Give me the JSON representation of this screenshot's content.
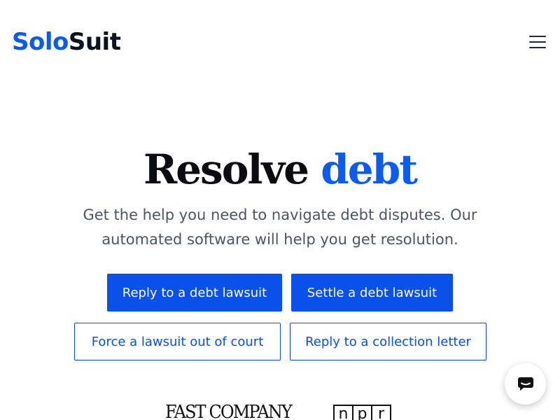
{
  "header": {
    "logo": {
      "part1": "Solo",
      "part2": "Suit"
    },
    "menu_icon": "hamburger-menu-icon"
  },
  "hero": {
    "headline": {
      "main": "Resolve ",
      "accent": "debt"
    },
    "subtext": "Get the help you need to navigate debt disputes. Our automated software will help you get resolution."
  },
  "actions": {
    "reply_lawsuit": "Reply to a debt lawsuit",
    "settle_lawsuit": "Settle a debt lawsuit",
    "force_out_of_court": "Force a lawsuit out of court",
    "reply_collection_letter": "Reply to a collection letter"
  },
  "press": {
    "fast_company": "FAST COMPANY",
    "npr": [
      "n",
      "p",
      "r"
    ]
  },
  "chat": {
    "icon": "chat-bubble-icon"
  },
  "colors": {
    "brand_blue": "#0a50ea",
    "logo_dark": "#0b1220",
    "text_gray": "#4a5566"
  }
}
